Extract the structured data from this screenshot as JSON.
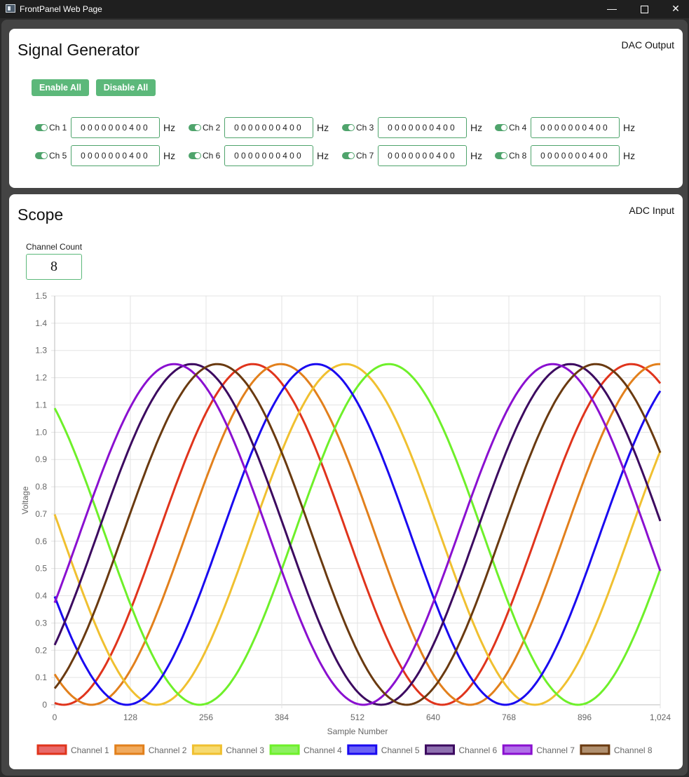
{
  "window": {
    "title": "FrontPanel Web Page",
    "minimize_glyph": "—",
    "close_glyph": "✕"
  },
  "generator": {
    "title": "Signal Generator",
    "tag": "DAC Output",
    "enable_all": "Enable All",
    "disable_all": "Disable All",
    "unit": "Hz",
    "channels": [
      {
        "label": "Ch 1",
        "value": "0000000400",
        "enabled": true
      },
      {
        "label": "Ch 2",
        "value": "0000000400",
        "enabled": true
      },
      {
        "label": "Ch 3",
        "value": "0000000400",
        "enabled": true
      },
      {
        "label": "Ch 4",
        "value": "0000000400",
        "enabled": true
      },
      {
        "label": "Ch 5",
        "value": "0000000400",
        "enabled": true
      },
      {
        "label": "Ch 6",
        "value": "0000000400",
        "enabled": true
      },
      {
        "label": "Ch 7",
        "value": "0000000400",
        "enabled": true
      },
      {
        "label": "Ch 8",
        "value": "0000000400",
        "enabled": true
      }
    ]
  },
  "scope": {
    "title": "Scope",
    "tag": "ADC Input",
    "channel_count_label": "Channel Count",
    "channel_count": "8"
  },
  "colors": {
    "accent": "#5cb87a",
    "toggle": "#4fa46c"
  },
  "chart_data": {
    "type": "line",
    "xlabel": "Sample Number",
    "ylabel": "Voltage",
    "xlim": [
      0,
      1024
    ],
    "ylim": [
      0,
      1.5
    ],
    "xticks": [
      0,
      128,
      256,
      384,
      512,
      640,
      768,
      896,
      1024
    ],
    "xtick_labels": [
      "0",
      "128",
      "256",
      "384",
      "512",
      "640",
      "768",
      "896",
      "1,024"
    ],
    "yticks": [
      0,
      0.1,
      0.2,
      0.3,
      0.4,
      0.5,
      0.6,
      0.7,
      0.8,
      0.9,
      1.0,
      1.1,
      1.2,
      1.3,
      1.4,
      1.5
    ],
    "ytick_labels": [
      "0",
      "0.1",
      "0.2",
      "0.3",
      "0.4",
      "0.5",
      "0.6",
      "0.7",
      "0.8",
      "0.9",
      "1.0",
      "1.1",
      "1.2",
      "1.3",
      "1.4",
      "1.5"
    ],
    "grid": true,
    "legend_position": "bottom",
    "series": [
      {
        "name": "Channel 1",
        "color": "#e0341c",
        "fill": "#e86a6a",
        "amplitude": 0.625,
        "offset": 0.625,
        "period": 640,
        "peak_at": 335
      },
      {
        "name": "Channel 2",
        "color": "#e2801c",
        "fill": "#f0aa5e",
        "amplitude": 0.625,
        "offset": 0.625,
        "period": 640,
        "peak_at": 382
      },
      {
        "name": "Channel 3",
        "color": "#f0c030",
        "fill": "#f6da70",
        "amplitude": 0.625,
        "offset": 0.625,
        "period": 640,
        "peak_at": 492
      },
      {
        "name": "Channel 4",
        "color": "#6ef02a",
        "fill": "#8cf060",
        "amplitude": 0.625,
        "offset": 0.625,
        "period": 640,
        "peak_at": 565
      },
      {
        "name": "Channel 5",
        "color": "#1a0af0",
        "fill": "#6b62f5",
        "amplitude": 0.625,
        "offset": 0.625,
        "period": 640,
        "peak_at": 442
      },
      {
        "name": "Channel 6",
        "color": "#3c0a60",
        "fill": "#8e70b0",
        "amplitude": 0.625,
        "offset": 0.625,
        "period": 640,
        "peak_at": 232
      },
      {
        "name": "Channel 7",
        "color": "#8a10d0",
        "fill": "#b070e8",
        "amplitude": 0.625,
        "offset": 0.625,
        "period": 640,
        "peak_at": 202
      },
      {
        "name": "Channel 8",
        "color": "#6a3a10",
        "fill": "#b09070",
        "amplitude": 0.625,
        "offset": 0.625,
        "period": 640,
        "peak_at": 275
      }
    ]
  }
}
